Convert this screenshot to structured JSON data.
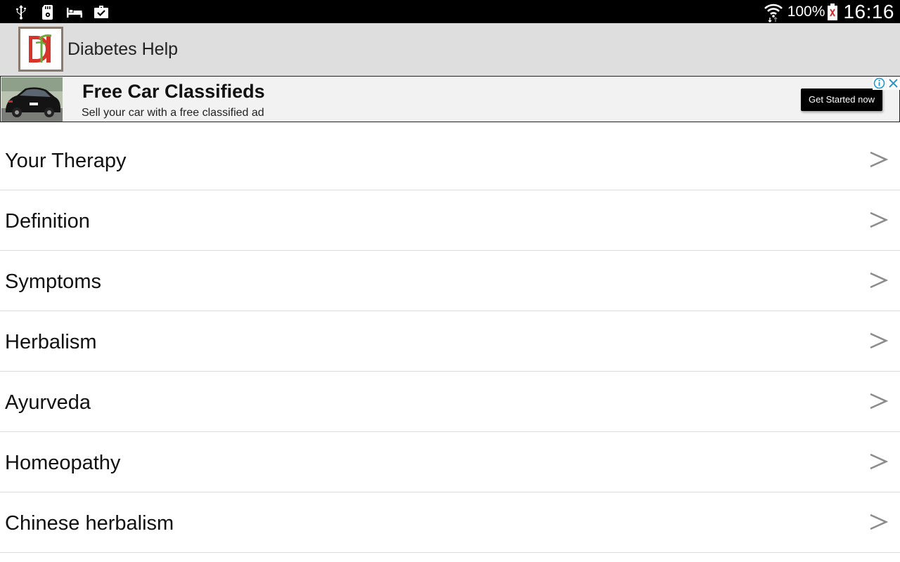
{
  "status_bar": {
    "icons": [
      "usb-icon",
      "sd-card-icon",
      "bed-icon",
      "briefcase-check-icon"
    ],
    "battery_percent": "100%",
    "time": "16:16"
  },
  "app": {
    "title": "Diabetes Help",
    "logo_icon": "diabetes-help-logo-icon"
  },
  "ad": {
    "headline": "Free Car Classifieds",
    "body": "Sell your car with a free classified ad",
    "cta": "Get Started now",
    "colors": {
      "info": "#1a9bd7",
      "close": "#1a9bd7"
    }
  },
  "menu": {
    "items": [
      {
        "label": "Your Therapy"
      },
      {
        "label": "Definition"
      },
      {
        "label": "Symptoms"
      },
      {
        "label": "Herbalism"
      },
      {
        "label": "Ayurveda"
      },
      {
        "label": "Homeopathy"
      },
      {
        "label": "Chinese herbalism"
      }
    ],
    "chevron_icon": "chevron-right-icon"
  }
}
